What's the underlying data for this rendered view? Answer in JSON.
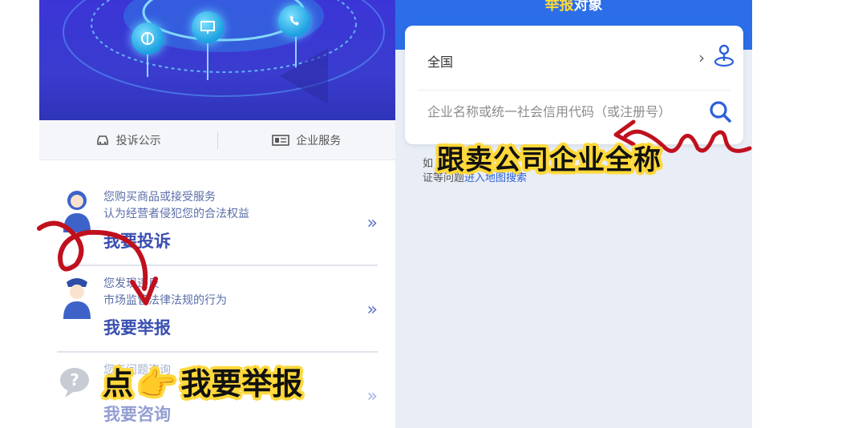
{
  "left": {
    "tabs": [
      {
        "label": "投诉公示",
        "icon": "car-icon"
      },
      {
        "label": "企业服务",
        "icon": "id-card-icon"
      }
    ],
    "items": [
      {
        "line1": "您购买商品或接受服务",
        "line2": "认为经营者侵犯您的合法权益",
        "title": "我要投诉",
        "chevron": "»",
        "icon": "female-agent-icon"
      },
      {
        "line1": "您发现违反",
        "line2": "市场监管法律法规的行为",
        "title": "我要举报",
        "chevron": "»",
        "icon": "officer-icon"
      },
      {
        "line1": "您有问题咨询",
        "line2": "",
        "title": "我要咨询",
        "chevron": "»",
        "icon": "question-bubble-icon"
      }
    ]
  },
  "right": {
    "title_hl": "举报",
    "title_rest": "对象",
    "region": "全国",
    "region_chevron": "›",
    "search_placeholder": "企业名称或统一社会信用代码（或注册号）",
    "hint_prefix": "如",
    "hint_line2": "证等问题",
    "hint_link": "进入地图搜索"
  },
  "overlay": {
    "right_caption": "跟卖公司企业全称",
    "left_caption_a": "点",
    "left_caption_b": "我要举报",
    "hand": "👉"
  },
  "colors": {
    "primary": "#2b6ee8",
    "hero": "#3b35d6",
    "link": "#2b62d9",
    "highlight": "#ffd83a",
    "annotation_red": "#c0101e"
  }
}
